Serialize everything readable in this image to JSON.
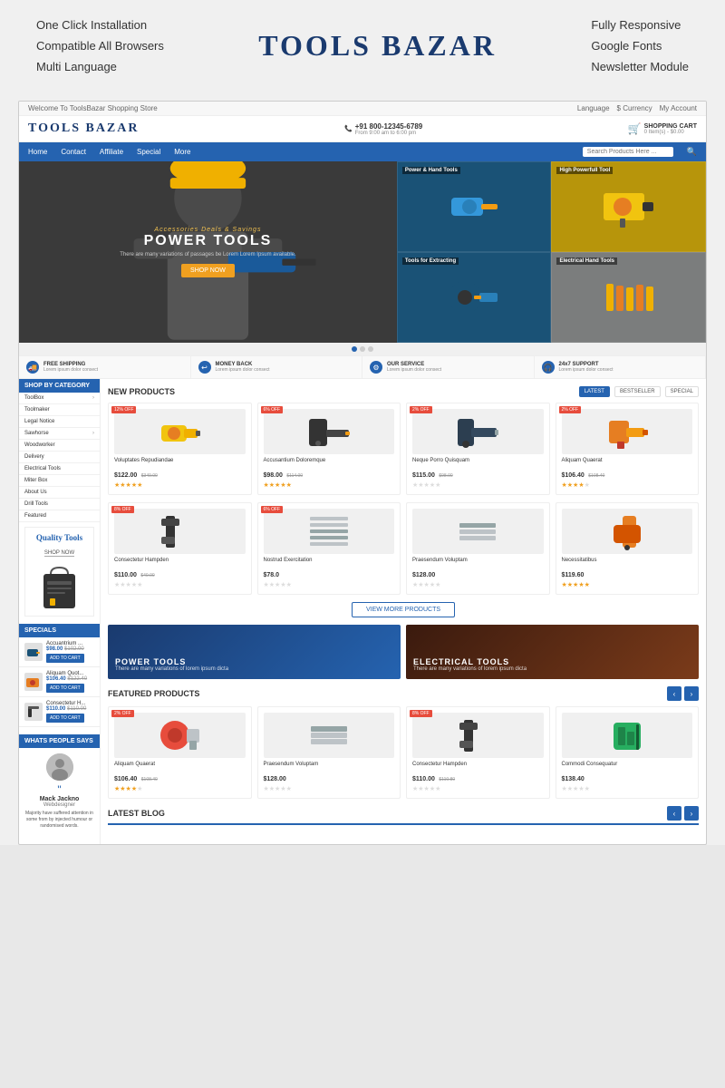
{
  "brand": {
    "name": "Tools Bazar",
    "logo": "TOOLS BAZAR"
  },
  "features_left": {
    "items": [
      "One Click Installation",
      "Compatible All Browsers",
      "Multi Language"
    ]
  },
  "features_right": {
    "items": [
      "Fully Responsive",
      "Google Fonts",
      "Newsletter Module"
    ]
  },
  "topbar": {
    "welcome": "Welcome To ToolsBazar Shopping Store",
    "language": "Language",
    "currency": "$ Currency",
    "account": "My Account"
  },
  "header": {
    "phone": "+91 800-12345-6789",
    "phone_hours": "From 9:00 am to 6:00 pm",
    "cart_label": "SHOPPING CART",
    "cart_info": "0 Item(s) - $0.00"
  },
  "nav": {
    "items": [
      "Home",
      "Contact",
      "Affiliate",
      "Special",
      "More"
    ],
    "search_placeholder": "Search Products Here ..."
  },
  "hero": {
    "badge": "Accessories Deals & Savings",
    "title": "POWER TOOLS",
    "description": "There are many variations of passages be Lorem Lorem Ipsum available.",
    "btn_label": "SHOP NOW",
    "side_items": [
      {
        "label": "Power & Hand Tools"
      },
      {
        "label": "High Powerfull Tool"
      },
      {
        "label": "Tools for Extracting"
      },
      {
        "label": "Electrical Hand Tools"
      }
    ]
  },
  "benefits": [
    {
      "icon": "truck-icon",
      "title": "FREE SHIPPING",
      "desc": "Lorem ipsum dolor consect"
    },
    {
      "icon": "undo-icon",
      "title": "MONEY BACK",
      "desc": "Lorem ipsum dolor consect"
    },
    {
      "icon": "gear-icon",
      "title": "OUR SERVICE",
      "desc": "Lorem ipsum dolor consect"
    },
    {
      "icon": "headset-icon",
      "title": "24x7 SUPPORT",
      "desc": "Lorem ipsum dolor consect"
    }
  ],
  "sidebar": {
    "category_title": "SHOP BY CATEGORY",
    "categories": [
      {
        "name": "ToolBox",
        "has_sub": true
      },
      {
        "name": "Toolmaker",
        "has_sub": false
      },
      {
        "name": "Legal Notice",
        "has_sub": false
      },
      {
        "name": "Sawhorse",
        "has_sub": true
      },
      {
        "name": "Woodworker",
        "has_sub": false
      },
      {
        "name": "Delivery",
        "has_sub": false
      },
      {
        "name": "Electrical Tools",
        "has_sub": false
      },
      {
        "name": "Miter Box",
        "has_sub": false
      },
      {
        "name": "About Us",
        "has_sub": false
      },
      {
        "name": "Drill Tools",
        "has_sub": false
      },
      {
        "name": "Featured",
        "has_sub": false
      }
    ],
    "quality_tools": {
      "title": "Quality Tools",
      "shop_now": "SHOP NOW"
    },
    "specials_title": "SPECIALS",
    "specials": [
      {
        "name": "Accuantrium ...",
        "price": "$98.00",
        "old_price": "$102.00",
        "btn": "ADD TO CART"
      },
      {
        "name": "Aliquam Quot...",
        "price": "$106.40",
        "old_price": "$122.40",
        "btn": "ADD TO CART"
      },
      {
        "name": "Consectetur H...",
        "price": "$110.00",
        "old_price": "$110.00",
        "btn": "ADD TO CART"
      }
    ],
    "whats_title": "WHATS PEOPLE SAYS",
    "testimonial": {
      "name": "Mack Jackno",
      "role": "Webdesigner",
      "quote": "Majority have suffered attention in some from by injected humour or randomised words."
    }
  },
  "new_products": {
    "title": "NEW PRODUCTS",
    "tabs": [
      "LATEST",
      "BESTSELLER",
      "SPECIAL"
    ],
    "active_tab": 0,
    "products_row1": [
      {
        "badge": "12% OFF",
        "name": "Voluptates Repudiandae",
        "price": "$122.00",
        "old_price": "$349.00",
        "stars": 5,
        "color": "yellow"
      },
      {
        "badge": "6% OFF",
        "name": "Accusantium Doloremque",
        "price": "$98.00",
        "old_price": "$114.00",
        "stars": 5,
        "color": "dark"
      },
      {
        "badge": "2% OFF",
        "name": "Neque Porro Quisquam",
        "price": "$115.00",
        "old_price": "$98.00",
        "stars": 1,
        "color": "dark"
      },
      {
        "badge": "2% OFF",
        "name": "Aliquam Quaerat",
        "price": "$106.40",
        "old_price": "$108.40",
        "stars": 4,
        "color": "orange"
      }
    ],
    "products_row2": [
      {
        "badge": "8% OFF",
        "name": "Consectetur Hampden",
        "price": "$110.00",
        "old_price": "$40.00",
        "stars": 1,
        "color": "dark"
      },
      {
        "badge": "6% OFF",
        "name": "Nostrud Exercitation",
        "price": "$78.0",
        "old_price": "",
        "stars": 1,
        "color": "silver"
      },
      {
        "badge": "",
        "name": "Praesendum Voluptam",
        "price": "$128.00",
        "old_price": "",
        "stars": 1,
        "color": "silver"
      },
      {
        "badge": "",
        "name": "Necessitatibus",
        "price": "$119.60",
        "old_price": "",
        "stars": 5,
        "color": "orange"
      }
    ],
    "view_more": "VIEW MORE PRODUCTS"
  },
  "promo_banners": [
    {
      "title": "POWER TOOLS",
      "desc": "There are many variations of lorem ipsum dicta"
    },
    {
      "title": "ELECTRICAL TOOLS",
      "desc": "There are many variations of lorem ipsum dicta"
    }
  ],
  "featured": {
    "title": "FEATURED PRODUCTS",
    "products": [
      {
        "badge": "2% OFF",
        "name": "Aliquam Quaerat",
        "price": "$106.40",
        "old_price": "$108.40",
        "stars": 4,
        "color": "orange"
      },
      {
        "badge": "",
        "name": "Praesendum Voluptam",
        "price": "$128.00",
        "old_price": "",
        "stars": 1,
        "color": "silver"
      },
      {
        "badge": "8% OFF",
        "name": "Consectetur Hampden",
        "price": "$110.00",
        "old_price": "$110.80",
        "stars": 1,
        "color": "dark"
      },
      {
        "badge": "",
        "name": "Commodi Consequatur",
        "price": "$138.40",
        "old_price": "",
        "stars": 1,
        "color": "blue"
      }
    ]
  },
  "blog": {
    "title": "LATEST BLOG"
  }
}
